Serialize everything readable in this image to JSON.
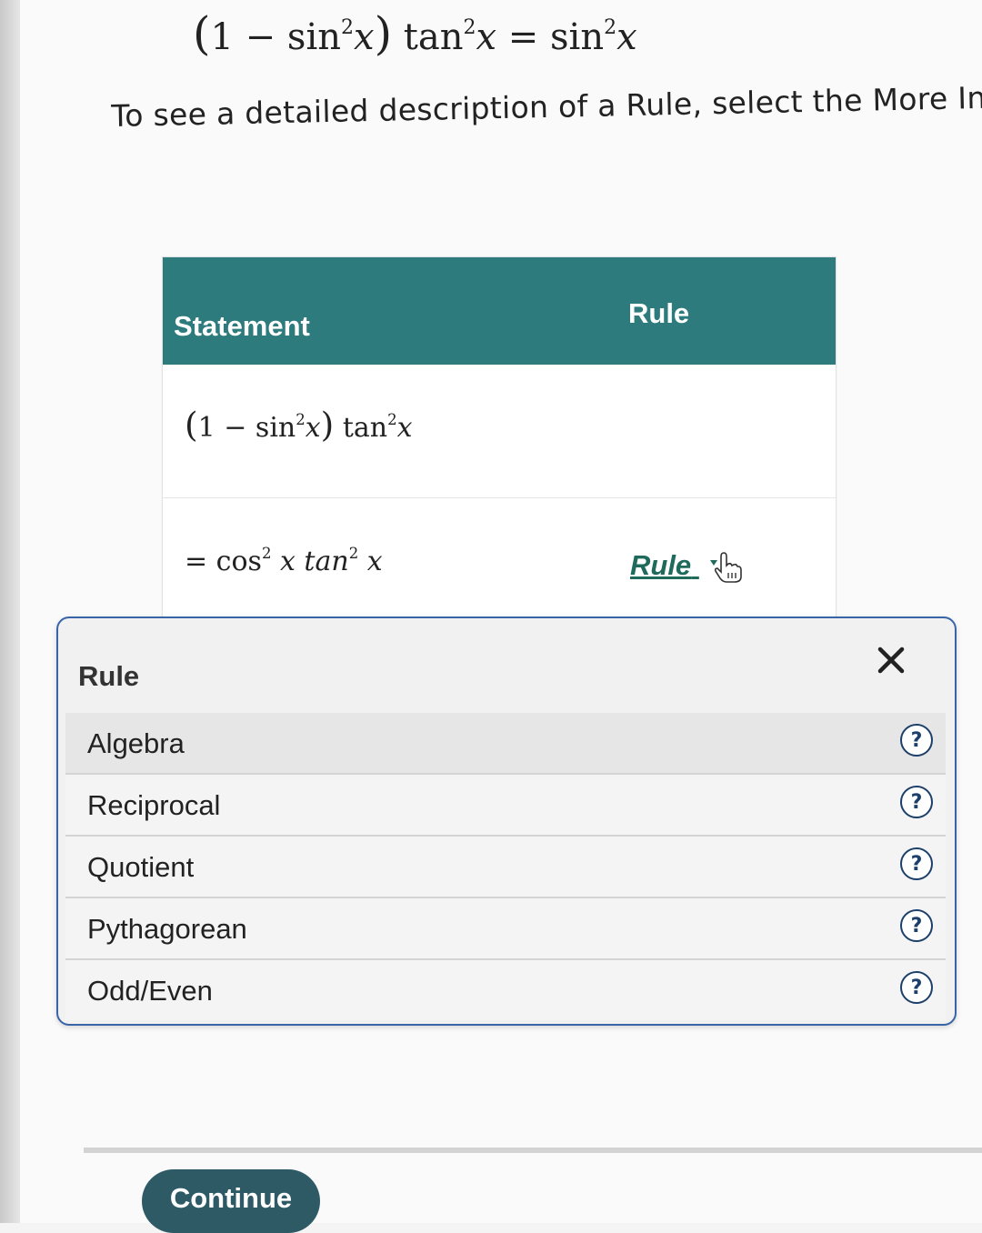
{
  "problem": {
    "lhs_open": "(",
    "one_minus": "1 − sin",
    "exp1": "2",
    "x1": "x",
    "lhs_close": ")",
    "tan": " tan",
    "exp2": "2",
    "x2": "x",
    "equals": " = sin",
    "exp3": "2",
    "x3": "x"
  },
  "instruction": "To see a detailed description of a Rule, select the More Inf",
  "table": {
    "header_statement": "Statement",
    "header_rule": "Rule",
    "row1": {
      "open": "(",
      "one_minus": "1 − sin",
      "exp1": "2",
      "x1": "x",
      "close": ")",
      "tan": " tan",
      "exp2": "2",
      "x2": "x"
    },
    "row2": {
      "eq": "= cos",
      "exp1": "2",
      "x1": " x tan",
      "exp2": "2",
      "x2": " x",
      "rule_label": "Rule"
    }
  },
  "popup": {
    "title": "Rule",
    "items": [
      {
        "label": "Algebra",
        "help": "?"
      },
      {
        "label": "Reciprocal",
        "help": "?"
      },
      {
        "label": "Quotient",
        "help": "?"
      },
      {
        "label": "Pythagorean",
        "help": "?"
      },
      {
        "label": "Odd/Even",
        "help": "?"
      }
    ]
  },
  "continue_label": "Continue",
  "icons": {
    "close": "close-icon",
    "help": "help-icon",
    "pointer": "hand-pointer-icon",
    "dropdown": "chevron-down-icon"
  },
  "colors": {
    "header_bg": "#2e7b7e",
    "rule_link": "#1e6b5c",
    "popup_border": "#3a64a8",
    "help_icon": "#1d3f6b",
    "continue_bg": "#2e5a66"
  }
}
